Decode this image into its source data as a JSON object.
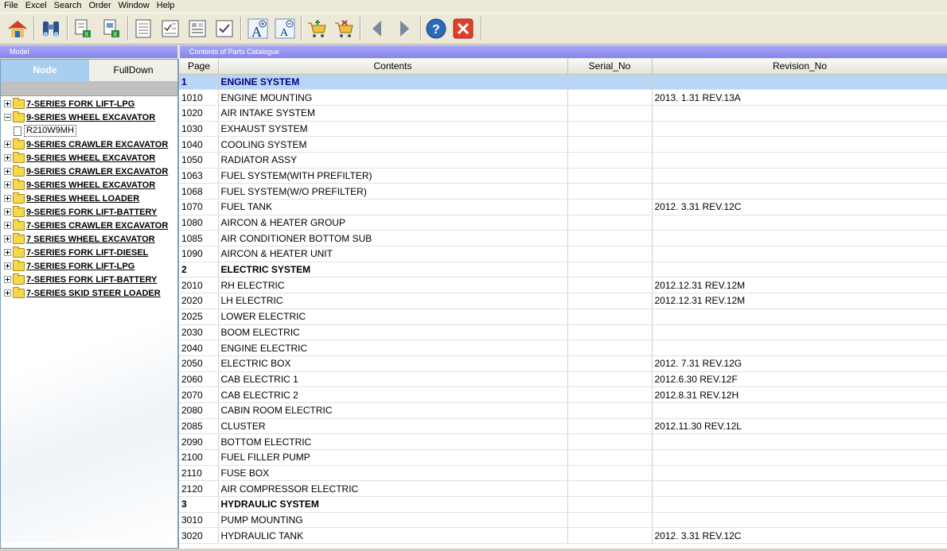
{
  "menu": [
    "File",
    "Excel",
    "Search",
    "Order",
    "Window",
    "Help"
  ],
  "toolbar": {
    "icons": [
      "home-icon",
      "binoculars-icon",
      "export-excel-icon",
      "export-excel-alt-icon",
      "document-list-icon",
      "document-checklist-icon",
      "document-grid-icon",
      "document-tick-icon",
      "zoom-in-text-icon",
      "zoom-out-text-icon",
      "cart-add-icon",
      "cart-remove-icon",
      "arrow-left-icon",
      "arrow-right-icon",
      "help-icon",
      "close-icon"
    ]
  },
  "captions": {
    "left": "Model",
    "right": "Contents of Parts Catalogue"
  },
  "tabs": {
    "node": "Node",
    "fulldown": "FullDown"
  },
  "tree": [
    {
      "label": "7-SERIES FORK LIFT-LPG",
      "expanded": false
    },
    {
      "label": "9-SERIES WHEEL EXCAVATOR",
      "expanded": true,
      "children": [
        "R210W9MH"
      ]
    },
    {
      "label": "9-SERIES CRAWLER EXCAVATOR",
      "expanded": false
    },
    {
      "label": "9-SERIES WHEEL EXCAVATOR",
      "expanded": false
    },
    {
      "label": "9-SERIES CRAWLER EXCAVATOR",
      "expanded": false
    },
    {
      "label": "9-SERIES WHEEL EXCAVATOR",
      "expanded": false
    },
    {
      "label": "9-SERIES WHEEL LOADER",
      "expanded": false
    },
    {
      "label": "9-SERIES FORK LIFT-BATTERY",
      "expanded": false
    },
    {
      "label": "7-SERIES CRAWLER EXCAVATOR",
      "expanded": false
    },
    {
      "label": "7 SERIES WHEEL EXCAVATOR",
      "expanded": false
    },
    {
      "label": "7-SERIES FORK LIFT-DIESEL",
      "expanded": false
    },
    {
      "label": "7-SERIES FORK LIFT-LPG",
      "expanded": false
    },
    {
      "label": "7-SERIES FORK LIFT-BATTERY",
      "expanded": false
    },
    {
      "label": "7-SERIES SKID STEER LOADER",
      "expanded": false
    }
  ],
  "table": {
    "headers": [
      "Page",
      "Contents",
      "Serial_No",
      "Revision_No"
    ],
    "rows": [
      {
        "page": "1",
        "contents": "ENGINE SYSTEM",
        "serial": "",
        "rev": "",
        "section": true,
        "selected": true
      },
      {
        "page": "1010",
        "contents": "ENGINE MOUNTING",
        "serial": "",
        "rev": "2013. 1.31  REV.13A"
      },
      {
        "page": "1020",
        "contents": "AIR INTAKE SYSTEM",
        "serial": "",
        "rev": ""
      },
      {
        "page": "1030",
        "contents": "EXHAUST SYSTEM",
        "serial": "",
        "rev": ""
      },
      {
        "page": "1040",
        "contents": "COOLING SYSTEM",
        "serial": "",
        "rev": ""
      },
      {
        "page": "1050",
        "contents": "RADIATOR ASSY",
        "serial": "",
        "rev": ""
      },
      {
        "page": "1063",
        "contents": "FUEL SYSTEM(WITH PREFILTER)",
        "serial": "",
        "rev": ""
      },
      {
        "page": "1068",
        "contents": "FUEL SYSTEM(W/O PREFILTER)",
        "serial": "",
        "rev": ""
      },
      {
        "page": "1070",
        "contents": "FUEL TANK",
        "serial": "",
        "rev": "2012. 3.31 REV.12C"
      },
      {
        "page": "1080",
        "contents": "AIRCON & HEATER GROUP",
        "serial": "",
        "rev": ""
      },
      {
        "page": "1085",
        "contents": "AIR CONDITIONER BOTTOM SUB",
        "serial": "",
        "rev": ""
      },
      {
        "page": "1090",
        "contents": "AIRCON & HEATER UNIT",
        "serial": "",
        "rev": ""
      },
      {
        "page": "2",
        "contents": "ELECTRIC SYSTEM",
        "serial": "",
        "rev": "",
        "section": true
      },
      {
        "page": "2010",
        "contents": "RH ELECTRIC",
        "serial": "",
        "rev": "2012.12.31  REV.12M"
      },
      {
        "page": "2020",
        "contents": "LH ELECTRIC",
        "serial": "",
        "rev": "2012.12.31  REV.12M"
      },
      {
        "page": "2025",
        "contents": "LOWER ELECTRIC",
        "serial": "",
        "rev": ""
      },
      {
        "page": "2030",
        "contents": "BOOM ELECTRIC",
        "serial": "",
        "rev": ""
      },
      {
        "page": "2040",
        "contents": "ENGINE ELECTRIC",
        "serial": "",
        "rev": ""
      },
      {
        "page": "2050",
        "contents": "ELECTRIC BOX",
        "serial": "",
        "rev": "2012. 7.31  REV.12G"
      },
      {
        "page": "2060",
        "contents": "CAB ELECTRIC 1",
        "serial": "",
        "rev": "2012.6.30  REV.12F"
      },
      {
        "page": "2070",
        "contents": "CAB ELECTRIC 2",
        "serial": "",
        "rev": "2012.8.31  REV.12H"
      },
      {
        "page": "2080",
        "contents": "CABIN ROOM ELECTRIC",
        "serial": "",
        "rev": ""
      },
      {
        "page": "2085",
        "contents": "CLUSTER",
        "serial": "",
        "rev": "2012.11.30  REV.12L"
      },
      {
        "page": "2090",
        "contents": "BOTTOM ELECTRIC",
        "serial": "",
        "rev": ""
      },
      {
        "page": "2100",
        "contents": "FUEL FILLER PUMP",
        "serial": "",
        "rev": ""
      },
      {
        "page": "2110",
        "contents": "FUSE BOX",
        "serial": "",
        "rev": ""
      },
      {
        "page": "2120",
        "contents": "AIR COMPRESSOR ELECTRIC",
        "serial": "",
        "rev": ""
      },
      {
        "page": "3",
        "contents": "HYDRAULIC SYSTEM",
        "serial": "",
        "rev": "",
        "section": true
      },
      {
        "page": "3010",
        "contents": "PUMP MOUNTING",
        "serial": "",
        "rev": ""
      },
      {
        "page": "3020",
        "contents": "HYDRAULIC TANK",
        "serial": "",
        "rev": "2012. 3.31 REV.12C"
      }
    ]
  }
}
